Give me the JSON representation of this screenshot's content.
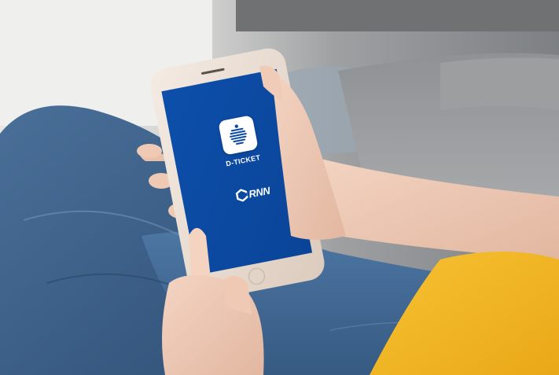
{
  "app": {
    "name": "D-TICKET",
    "icon": "d-ticket-app-icon"
  },
  "publisher": {
    "logo_letters": "RNN",
    "logo_icon": "rnn-hexagon-logo-icon",
    "tagline": ""
  },
  "colors": {
    "screen_blue": "#0b4aa2",
    "phone_frame": "#e9dcd2",
    "denim": "#3d6189",
    "sweater_yellow": "#f2b521",
    "couch_gray": "#8e9092"
  }
}
